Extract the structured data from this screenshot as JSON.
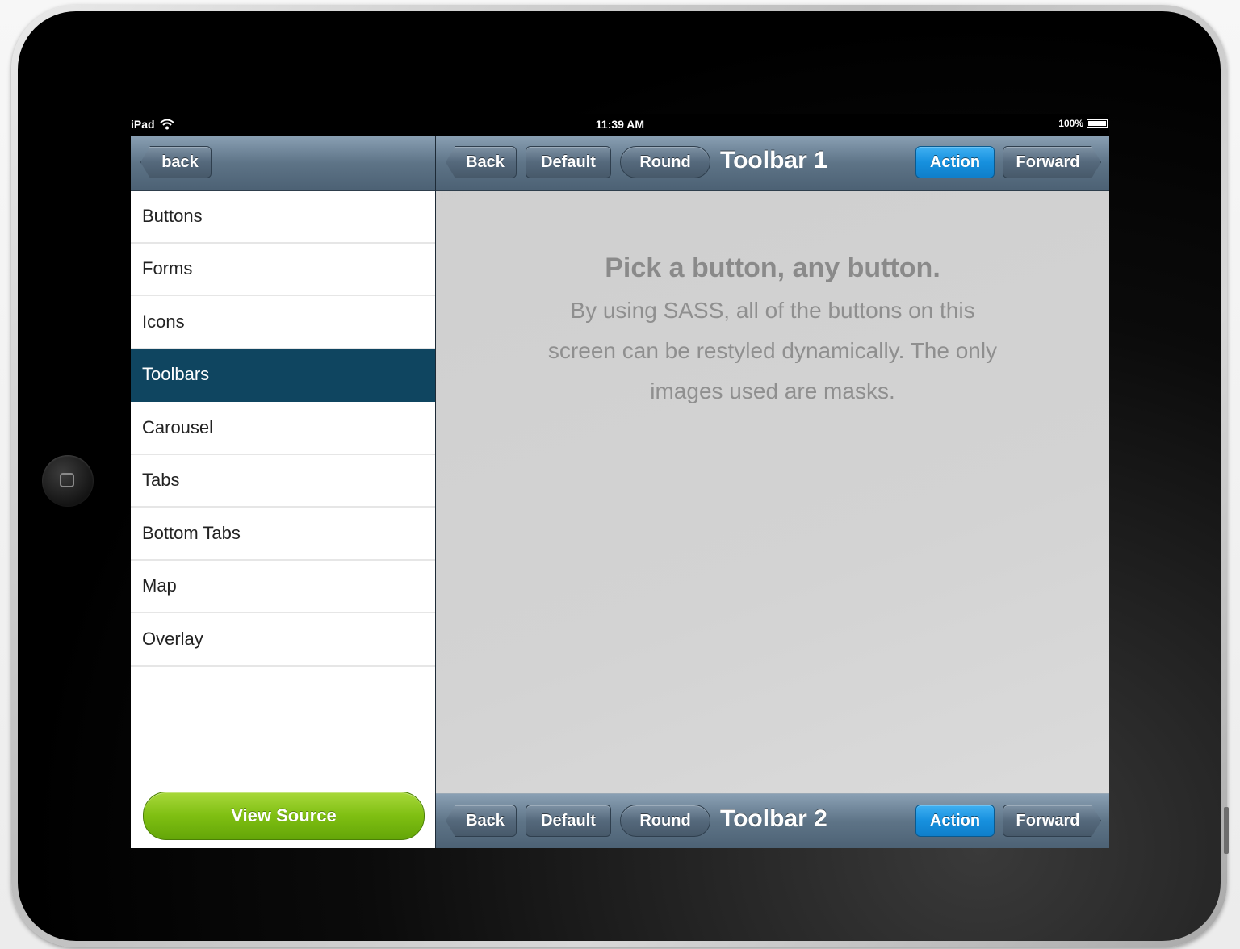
{
  "status_bar": {
    "device": "iPad",
    "time": "11:39 AM",
    "battery": "100%"
  },
  "sidebar": {
    "back_label": "back",
    "items": [
      {
        "label": "Buttons"
      },
      {
        "label": "Forms"
      },
      {
        "label": "Icons"
      },
      {
        "label": "Toolbars"
      },
      {
        "label": "Carousel"
      },
      {
        "label": "Tabs"
      },
      {
        "label": "Bottom Tabs"
      },
      {
        "label": "Map"
      },
      {
        "label": "Overlay"
      }
    ],
    "selected_item": "Toolbars",
    "view_source_label": "View Source"
  },
  "toolbar_top": {
    "back": "Back",
    "default": "Default",
    "round": "Round",
    "title": "Toolbar 1",
    "action": "Action",
    "forward": "Forward"
  },
  "toolbar_bottom": {
    "back": "Back",
    "default": "Default",
    "round": "Round",
    "title": "Toolbar 2",
    "action": "Action",
    "forward": "Forward"
  },
  "main": {
    "message_title": "Pick a button, any button.",
    "message_body": "By using SASS, all of the buttons on this screen can be restyled dynamically. The only images used are masks."
  },
  "colors": {
    "toolbar": "#5e7487",
    "selected_item": "#0f4560",
    "action_button": "#1790de",
    "view_source": "#7fbf12"
  },
  "icons": [
    "wifi-icon",
    "battery-icon",
    "home-button-icon"
  ]
}
